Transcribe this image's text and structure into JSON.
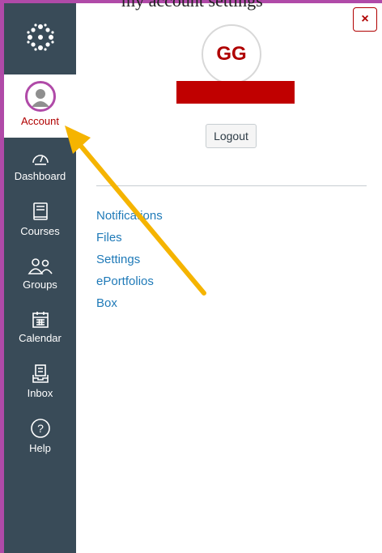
{
  "caption": {
    "text": "my account settings"
  },
  "colors": {
    "nav_bg": "#394B58",
    "accent_red": "#b00000",
    "frame_purple": "#b04aa8",
    "link_blue": "#1f7ab8",
    "arrow": "#f5b400"
  },
  "nav": {
    "logo_icon": "canvas-logo-icon",
    "items": [
      {
        "label": "Account",
        "icon": "avatar-icon"
      },
      {
        "label": "Dashboard",
        "icon": "dashboard-icon"
      },
      {
        "label": "Courses",
        "icon": "book-icon"
      },
      {
        "label": "Groups",
        "icon": "groups-icon"
      },
      {
        "label": "Calendar",
        "icon": "calendar-icon"
      },
      {
        "label": "Inbox",
        "icon": "inbox-icon"
      },
      {
        "label": "Help",
        "icon": "help-icon"
      }
    ]
  },
  "tray": {
    "close_label": "×",
    "avatar_initials": "GG",
    "logout_label": "Logout",
    "links": [
      "Notifications",
      "Files",
      "Settings",
      "ePortfolios",
      "Box"
    ]
  }
}
